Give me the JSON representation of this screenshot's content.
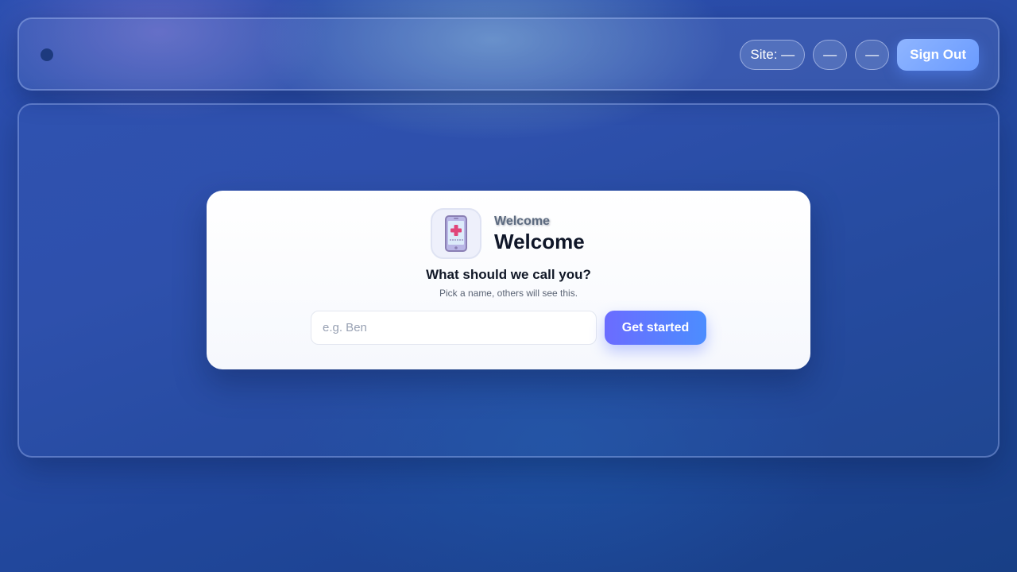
{
  "topbar": {
    "site_label": "Site: —",
    "pill_2": "—",
    "pill_3": "—",
    "sign_out_label": "Sign Out"
  },
  "card": {
    "icon": "medical-phone-icon",
    "eyebrow": "Welcome",
    "title": "Welcome",
    "question": "What should we call you?",
    "hint": "Pick a name, others will see this.",
    "name_input": {
      "placeholder": "e.g. Ben",
      "value": ""
    },
    "submit_label": "Get started"
  },
  "colors": {
    "accent_start": "#6b6cff",
    "accent_end": "#4c8dff",
    "sign_out": "#7aa6ff",
    "background": "#2a4ca8"
  }
}
